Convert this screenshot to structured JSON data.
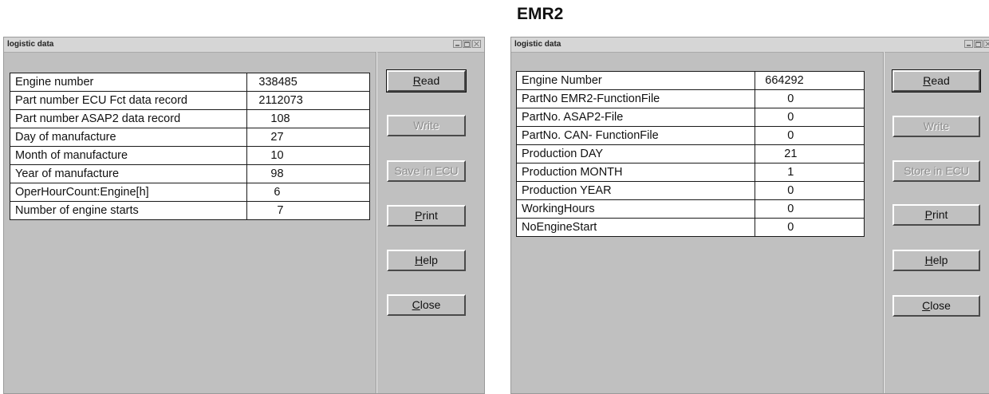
{
  "heading": "EMR2",
  "left_window": {
    "title": "logistic data",
    "rows": [
      {
        "label": "Engine number",
        "value": "338485"
      },
      {
        "label": "Part number ECU Fct data record",
        "value": "2112073"
      },
      {
        "label": "Part number ASAP2 data record",
        "value": "108"
      },
      {
        "label": "Day of manufacture",
        "value": "27"
      },
      {
        "label": "Month of manufacture",
        "value": "10"
      },
      {
        "label": "Year of manufacture",
        "value": "98"
      },
      {
        "label": "OperHourCount:Engine[h]",
        "value": "6"
      },
      {
        "label": "Number of engine starts",
        "value": "7"
      }
    ],
    "buttons": {
      "read": {
        "mnemonic": "R",
        "rest": "ead"
      },
      "write": "Write",
      "save": "Save in ECU",
      "print": {
        "mnemonic": "P",
        "rest": "rint"
      },
      "help": {
        "mnemonic": "H",
        "rest": "elp"
      },
      "close": {
        "mnemonic": "C",
        "rest": "lose"
      }
    }
  },
  "right_window": {
    "title": "logistic data",
    "rows": [
      {
        "label": "Engine Number",
        "value": "664292"
      },
      {
        "label": "PartNo EMR2-FunctionFile",
        "value": "0"
      },
      {
        "label": "PartNo. ASAP2-File",
        "value": "0"
      },
      {
        "label": "PartNo. CAN- FunctionFile",
        "value": "0"
      },
      {
        "label": "Production DAY",
        "value": "21"
      },
      {
        "label": "Production MONTH",
        "value": "1"
      },
      {
        "label": "Production YEAR",
        "value": "0"
      },
      {
        "label": "WorkingHours",
        "value": "0"
      },
      {
        "label": "NoEngineStart",
        "value": "0"
      }
    ],
    "buttons": {
      "read": {
        "mnemonic": "R",
        "rest": "ead"
      },
      "write": "Write",
      "store": "Store in ECU",
      "print": {
        "mnemonic": "P",
        "rest": "rint"
      },
      "help": {
        "mnemonic": "H",
        "rest": "elp"
      },
      "close": {
        "mnemonic": "C",
        "rest": "lose"
      }
    }
  }
}
